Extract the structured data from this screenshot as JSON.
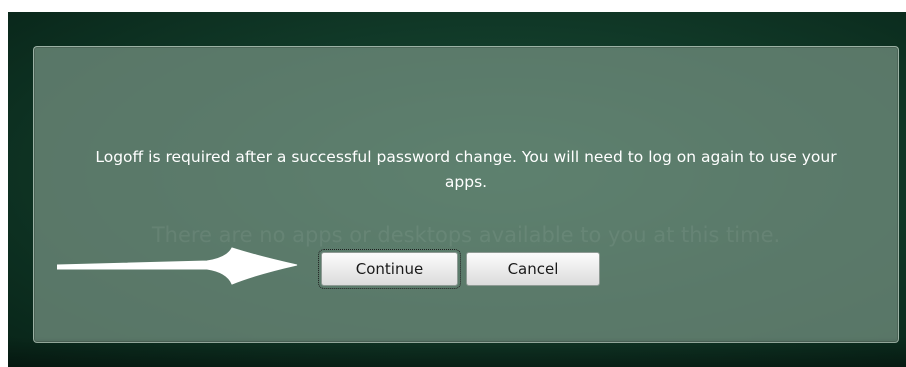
{
  "dialog": {
    "message": "Logoff is required after a successful password change. You will need to log on again to use your apps.",
    "background_text": "There are no apps or desktops available to you at this time.",
    "continue_label": "Continue",
    "cancel_label": "Cancel"
  },
  "annotation": {
    "icon": "arrow-right-icon",
    "color": "#ffffff"
  },
  "colors": {
    "backdrop": "#123c2a",
    "dialog": "#708c7c",
    "text": "#ffffff"
  }
}
